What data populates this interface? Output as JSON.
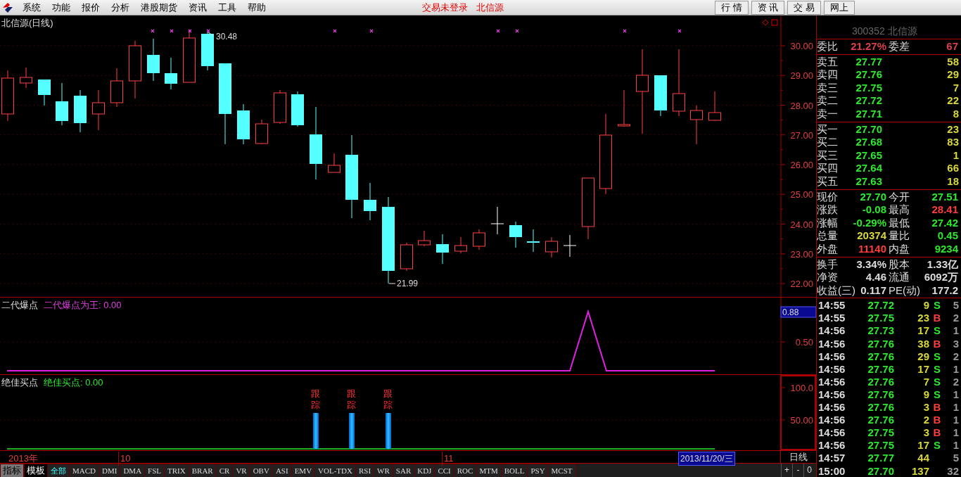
{
  "menu_bar": {
    "items": [
      "系统",
      "功能",
      "报价",
      "分析",
      "港股期货",
      "资讯",
      "工具",
      "帮助"
    ],
    "status": "交易未登录",
    "broker": "北信源",
    "buttons": [
      "行 情",
      "资 讯",
      "交 易",
      "网上"
    ]
  },
  "price_chart": {
    "title": "北信源(日线)",
    "high_label": "30.48",
    "low_label": "21.99",
    "y_axis": [
      "30.00",
      "29.00",
      "28.00",
      "27.00",
      "26.00",
      "25.00",
      "24.00",
      "23.00",
      "22.00"
    ]
  },
  "indicator_1": {
    "name": "二代爆点",
    "series_label": "二代爆点为王: 0.00",
    "y_axis": [
      "0.50"
    ],
    "cursor_value": "0.88"
  },
  "indicator_2": {
    "name": "绝佳买点",
    "series_label": "绝佳买点: 0.00",
    "y_axis": [
      "100.0",
      "50.00"
    ],
    "signals": [
      {
        "text": "跟踪"
      },
      {
        "text": "跟踪"
      },
      {
        "text": "跟踪"
      }
    ]
  },
  "date_axis": {
    "labels": [
      "2013年",
      "10",
      "11"
    ],
    "cursor_date": "2013/11/20/三",
    "period": "日线"
  },
  "mode_tabs": [
    {
      "label": "指标",
      "selected": true
    },
    {
      "label": "模板",
      "selected": false
    }
  ],
  "indicator_tabs": [
    {
      "label": "全部",
      "selected": true
    },
    {
      "label": "MACD",
      "selected": false
    },
    {
      "label": "DMI",
      "selected": false
    },
    {
      "label": "DMA",
      "selected": false
    },
    {
      "label": "FSL",
      "selected": false
    },
    {
      "label": "TRIX",
      "selected": false
    },
    {
      "label": "BRAR",
      "selected": false
    },
    {
      "label": "CR",
      "selected": false
    },
    {
      "label": "VR",
      "selected": false
    },
    {
      "label": "OBV",
      "selected": false
    },
    {
      "label": "ASI",
      "selected": false
    },
    {
      "label": "EMV",
      "selected": false
    },
    {
      "label": "VOL-TDX",
      "selected": false
    },
    {
      "label": "RSI",
      "selected": false
    },
    {
      "label": "WR",
      "selected": false
    },
    {
      "label": "SAR",
      "selected": false
    },
    {
      "label": "KDJ",
      "selected": false
    },
    {
      "label": "CCI",
      "selected": false
    },
    {
      "label": "ROC",
      "selected": false
    },
    {
      "label": "MTM",
      "selected": false
    },
    {
      "label": "BOLL",
      "selected": false
    },
    {
      "label": "PSY",
      "selected": false
    },
    {
      "label": "MCST",
      "selected": false
    }
  ],
  "zoom_buttons": [
    "+",
    "-",
    "0"
  ],
  "quote_panel": {
    "header": "300352 北信源",
    "ratio": [
      {
        "label": "委比",
        "value": "21.27%"
      },
      {
        "label": "委差",
        "value": "67"
      }
    ],
    "asks": [
      {
        "label": "卖五",
        "price": "27.77",
        "volume": "58"
      },
      {
        "label": "卖四",
        "price": "27.76",
        "volume": "29"
      },
      {
        "label": "卖三",
        "price": "27.75",
        "volume": "7"
      },
      {
        "label": "卖二",
        "price": "27.72",
        "volume": "22"
      },
      {
        "label": "卖一",
        "price": "27.71",
        "volume": "8"
      }
    ],
    "bids": [
      {
        "label": "买一",
        "price": "27.70",
        "volume": "23"
      },
      {
        "label": "买二",
        "price": "27.68",
        "volume": "83"
      },
      {
        "label": "买三",
        "price": "27.65",
        "volume": "1"
      },
      {
        "label": "买四",
        "price": "27.64",
        "volume": "66"
      },
      {
        "label": "买五",
        "price": "27.63",
        "volume": "18"
      }
    ],
    "stats": [
      {
        "label": "现价",
        "value": "27.70",
        "color": "#2ee82e"
      },
      {
        "label": "今开",
        "value": "27.51",
        "color": "#2ee82e"
      },
      {
        "label": "涨跌",
        "value": "-0.08",
        "color": "#2ee82e"
      },
      {
        "label": "最高",
        "value": "28.41",
        "color": "#ff3c3c"
      },
      {
        "label": "涨幅",
        "value": "-0.29%",
        "color": "#2ee82e"
      },
      {
        "label": "最低",
        "value": "27.42",
        "color": "#2ee82e"
      },
      {
        "label": "总量",
        "value": "20374",
        "color": "#d8d83a"
      },
      {
        "label": "量比",
        "value": "0.45",
        "color": "#2ee82e"
      },
      {
        "label": "外盘",
        "value": "11140",
        "color": "#ff3c3c"
      },
      {
        "label": "内盘",
        "value": "9234",
        "color": "#2ee82e"
      }
    ],
    "fundamentals": [
      {
        "label": "换手",
        "value": "3.34%"
      },
      {
        "label": "股本",
        "value": "1.33亿"
      },
      {
        "label": "净资",
        "value": "4.46"
      },
      {
        "label": "流通",
        "value": "6092万"
      },
      {
        "label": "收益(三)",
        "value": "0.117"
      },
      {
        "label": "PE(动)",
        "value": "177.2"
      }
    ]
  },
  "trades": [
    {
      "time": "14:55",
      "price": "27.72",
      "volume": "9",
      "side": "S",
      "color": "#2ee82e",
      "count": "5"
    },
    {
      "time": "14:55",
      "price": "27.75",
      "volume": "23",
      "side": "B",
      "color": "#ff3c3c",
      "count": "2"
    },
    {
      "time": "14:56",
      "price": "27.73",
      "volume": "17",
      "side": "S",
      "color": "#2ee82e",
      "count": "1"
    },
    {
      "time": "14:56",
      "price": "27.76",
      "volume": "38",
      "side": "B",
      "color": "#ff3c3c",
      "count": "3"
    },
    {
      "time": "14:56",
      "price": "27.76",
      "volume": "29",
      "side": "S",
      "color": "#2ee82e",
      "count": "2"
    },
    {
      "time": "14:56",
      "price": "27.76",
      "volume": "17",
      "side": "S",
      "color": "#2ee82e",
      "count": "1"
    },
    {
      "time": "14:56",
      "price": "27.76",
      "volume": "7",
      "side": "S",
      "color": "#2ee82e",
      "count": "2"
    },
    {
      "time": "14:56",
      "price": "27.76",
      "volume": "9",
      "side": "S",
      "color": "#2ee82e",
      "count": "1"
    },
    {
      "time": "14:56",
      "price": "27.76",
      "volume": "3",
      "side": "B",
      "color": "#ff3c3c",
      "count": "1"
    },
    {
      "time": "14:56",
      "price": "27.76",
      "volume": "2",
      "side": "B",
      "color": "#ff3c3c",
      "count": "1"
    },
    {
      "time": "14:56",
      "price": "27.75",
      "volume": "3",
      "side": "B",
      "color": "#ff3c3c",
      "count": "1"
    },
    {
      "time": "14:56",
      "price": "27.75",
      "volume": "17",
      "side": "S",
      "color": "#2ee82e",
      "count": "1"
    },
    {
      "time": "14:57",
      "price": "27.77",
      "volume": "44",
      "count": "5"
    },
    {
      "time": "15:00",
      "price": "27.70",
      "volume": "137",
      "count": "32"
    }
  ]
}
